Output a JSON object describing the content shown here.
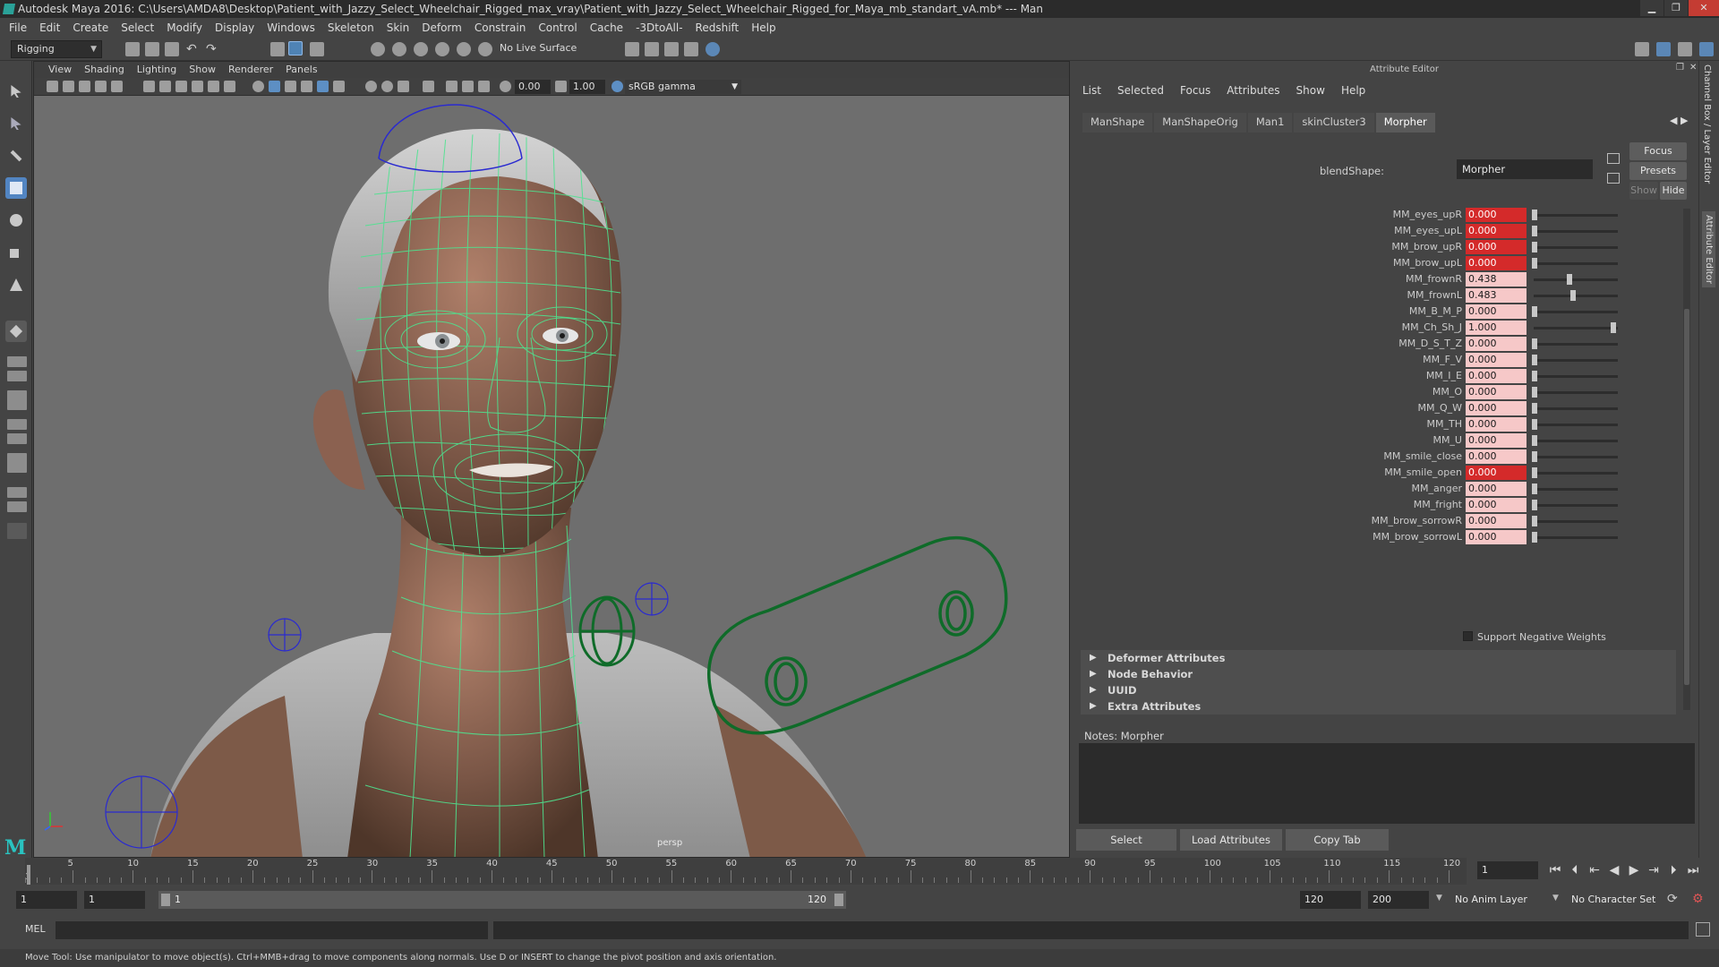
{
  "title_bar": {
    "text": "Autodesk Maya 2016: C:\\Users\\AMDA8\\Desktop\\Patient_with_Jazzy_Select_Wheelchair_Rigged_max_vray\\Patient_with_Jazzy_Select_Wheelchair_Rigged_for_Maya_mb_standart_vA.mb*   ---   Man"
  },
  "menu": [
    "File",
    "Edit",
    "Create",
    "Select",
    "Modify",
    "Display",
    "Windows",
    "Skeleton",
    "Skin",
    "Deform",
    "Constrain",
    "Control",
    "Cache",
    "-3DtoAll-",
    "Redshift",
    "Help"
  ],
  "status_line": {
    "menu_set": "Rigging",
    "live_surface": "No Live Surface"
  },
  "viewport": {
    "menu": [
      "View",
      "Shading",
      "Lighting",
      "Show",
      "Renderer",
      "Panels"
    ],
    "exposure": "0.00",
    "gamma": "1.00",
    "color_space": "sRGB gamma",
    "camera_label": "persp"
  },
  "attribute_editor": {
    "title": "Attribute Editor",
    "menu": [
      "List",
      "Selected",
      "Focus",
      "Attributes",
      "Show",
      "Help"
    ],
    "tabs": [
      "ManShape",
      "ManShapeOrig",
      "Man1",
      "skinCluster3",
      "Morpher"
    ],
    "active_tab": "Morpher",
    "blendshape_label": "blendShape:",
    "blendshape_value": "Morpher",
    "buttons": {
      "focus": "Focus",
      "presets": "Presets",
      "show": "Show",
      "hide": "Hide"
    },
    "attributes": [
      {
        "name": "MM_eyes_upR",
        "value": "0.000",
        "fraction": 0.0,
        "keyed": true
      },
      {
        "name": "MM_eyes_upL",
        "value": "0.000",
        "fraction": 0.0,
        "keyed": true
      },
      {
        "name": "MM_brow_upR",
        "value": "0.000",
        "fraction": 0.0,
        "keyed": true
      },
      {
        "name": "MM_brow_upL",
        "value": "0.000",
        "fraction": 0.0,
        "keyed": true
      },
      {
        "name": "MM_frownR",
        "value": "0.438",
        "fraction": 0.438,
        "keyed": false
      },
      {
        "name": "MM_frownL",
        "value": "0.483",
        "fraction": 0.483,
        "keyed": false
      },
      {
        "name": "MM_B_M_P",
        "value": "0.000",
        "fraction": 0.0,
        "keyed": false
      },
      {
        "name": "MM_Ch_Sh_J",
        "value": "1.000",
        "fraction": 1.0,
        "keyed": false
      },
      {
        "name": "MM_D_S_T_Z",
        "value": "0.000",
        "fraction": 0.0,
        "keyed": false
      },
      {
        "name": "MM_F_V",
        "value": "0.000",
        "fraction": 0.0,
        "keyed": false
      },
      {
        "name": "MM_I_E",
        "value": "0.000",
        "fraction": 0.0,
        "keyed": false
      },
      {
        "name": "MM_O",
        "value": "0.000",
        "fraction": 0.0,
        "keyed": false
      },
      {
        "name": "MM_Q_W",
        "value": "0.000",
        "fraction": 0.0,
        "keyed": false
      },
      {
        "name": "MM_TH",
        "value": "0.000",
        "fraction": 0.0,
        "keyed": false
      },
      {
        "name": "MM_U",
        "value": "0.000",
        "fraction": 0.0,
        "keyed": false
      },
      {
        "name": "MM_smile_close",
        "value": "0.000",
        "fraction": 0.0,
        "keyed": false
      },
      {
        "name": "MM_smile_open",
        "value": "0.000",
        "fraction": 0.0,
        "keyed": true
      },
      {
        "name": "MM_anger",
        "value": "0.000",
        "fraction": 0.0,
        "keyed": false
      },
      {
        "name": "MM_fright",
        "value": "0.000",
        "fraction": 0.0,
        "keyed": false
      },
      {
        "name": "MM_brow_sorrowR",
        "value": "0.000",
        "fraction": 0.0,
        "keyed": false
      },
      {
        "name": "MM_brow_sorrowL",
        "value": "0.000",
        "fraction": 0.0,
        "keyed": false
      }
    ],
    "support_negative_weights": "Support Negative Weights",
    "sections": [
      "Deformer Attributes",
      "Node Behavior",
      "UUID",
      "Extra Attributes"
    ],
    "notes_label": "Notes:  Morpher",
    "bottom_buttons": [
      "Select",
      "Load Attributes",
      "Copy Tab"
    ],
    "side_tabs": [
      "Channel Box / Layer Editor",
      "Attribute Editor"
    ]
  },
  "time_slider": {
    "ticks": [
      5,
      10,
      15,
      20,
      25,
      30,
      35,
      40,
      45,
      50,
      55,
      60,
      65,
      70,
      75,
      80,
      85,
      90,
      95,
      100,
      105,
      110,
      115,
      120
    ],
    "first_tick": "1",
    "current_frame": "1"
  },
  "range_slider": {
    "start": "1",
    "playback_start": "1",
    "range_start_label": "1",
    "range_end_label": "120",
    "playback_end": "120",
    "end": "200",
    "anim_layer": "No Anim Layer",
    "character_set": "No Character Set"
  },
  "command_line": {
    "label": "MEL"
  },
  "help_line": "Move Tool: Use manipulator to move object(s). Ctrl+MMB+drag to move components along normals. Use D or INSERT to change the pivot position and axis orientation.",
  "colors": {
    "keyed_field": "#d42a2a",
    "unkeyed_field": "#f6c8c8",
    "active_tool": "#5285c2",
    "wireframe": "#4ee38f",
    "controller": "#0f6b29",
    "joint": "#2a2ad0"
  }
}
